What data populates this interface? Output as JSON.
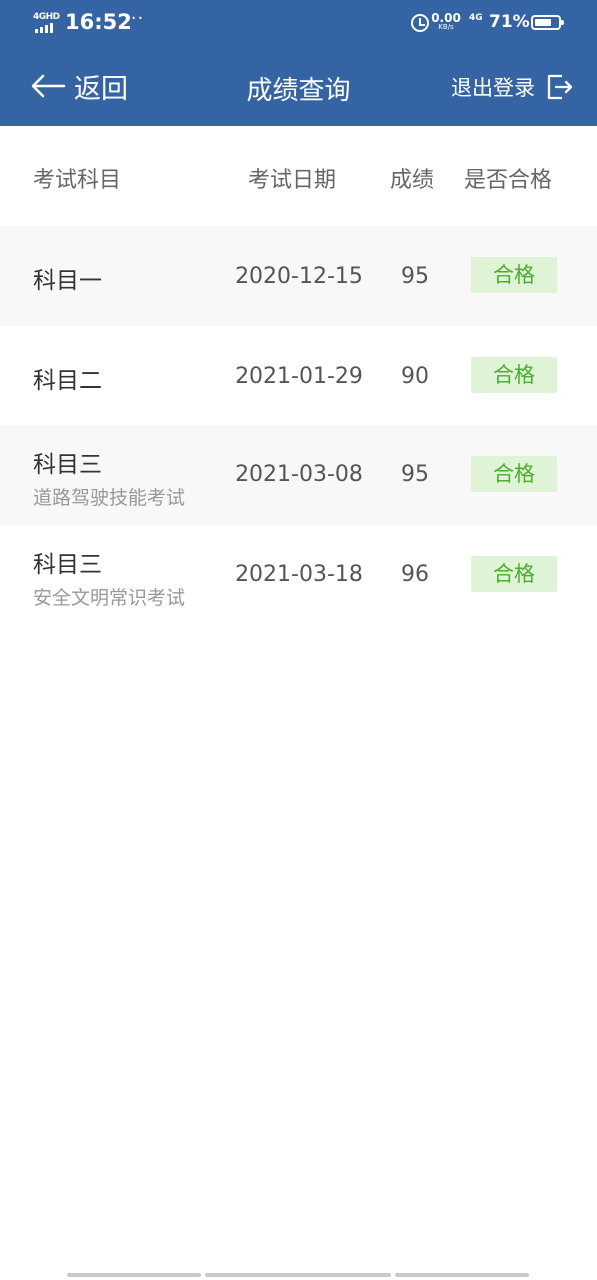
{
  "status_bar": {
    "network": "4GHD",
    "time": "16:52",
    "more": "···",
    "speed_value": "0.00",
    "speed_unit": "KB/s",
    "signal2": "4G",
    "battery_percent": "71%",
    "battery_level": 0.71
  },
  "nav": {
    "back_label": "返回",
    "title": "成绩查询",
    "logout_label": "退出登录"
  },
  "table": {
    "headers": {
      "subject": "考试科目",
      "date": "考试日期",
      "score": "成绩",
      "pass": "是否合格"
    },
    "rows": [
      {
        "subject": "科目一",
        "subtitle": "",
        "date": "2020-12-15",
        "score": "95",
        "status": "合格"
      },
      {
        "subject": "科目二",
        "subtitle": "",
        "date": "2021-01-29",
        "score": "90",
        "status": "合格"
      },
      {
        "subject": "科目三",
        "subtitle": "道路驾驶技能考试",
        "date": "2021-03-08",
        "score": "95",
        "status": "合格"
      },
      {
        "subject": "科目三",
        "subtitle": "安全文明常识考试",
        "date": "2021-03-18",
        "score": "96",
        "status": "合格"
      }
    ]
  },
  "colors": {
    "header_bg": "#3464a4",
    "pass_bg": "#dff3d6",
    "pass_text": "#4cae2f",
    "alt_row_bg": "#f8f8f8"
  }
}
